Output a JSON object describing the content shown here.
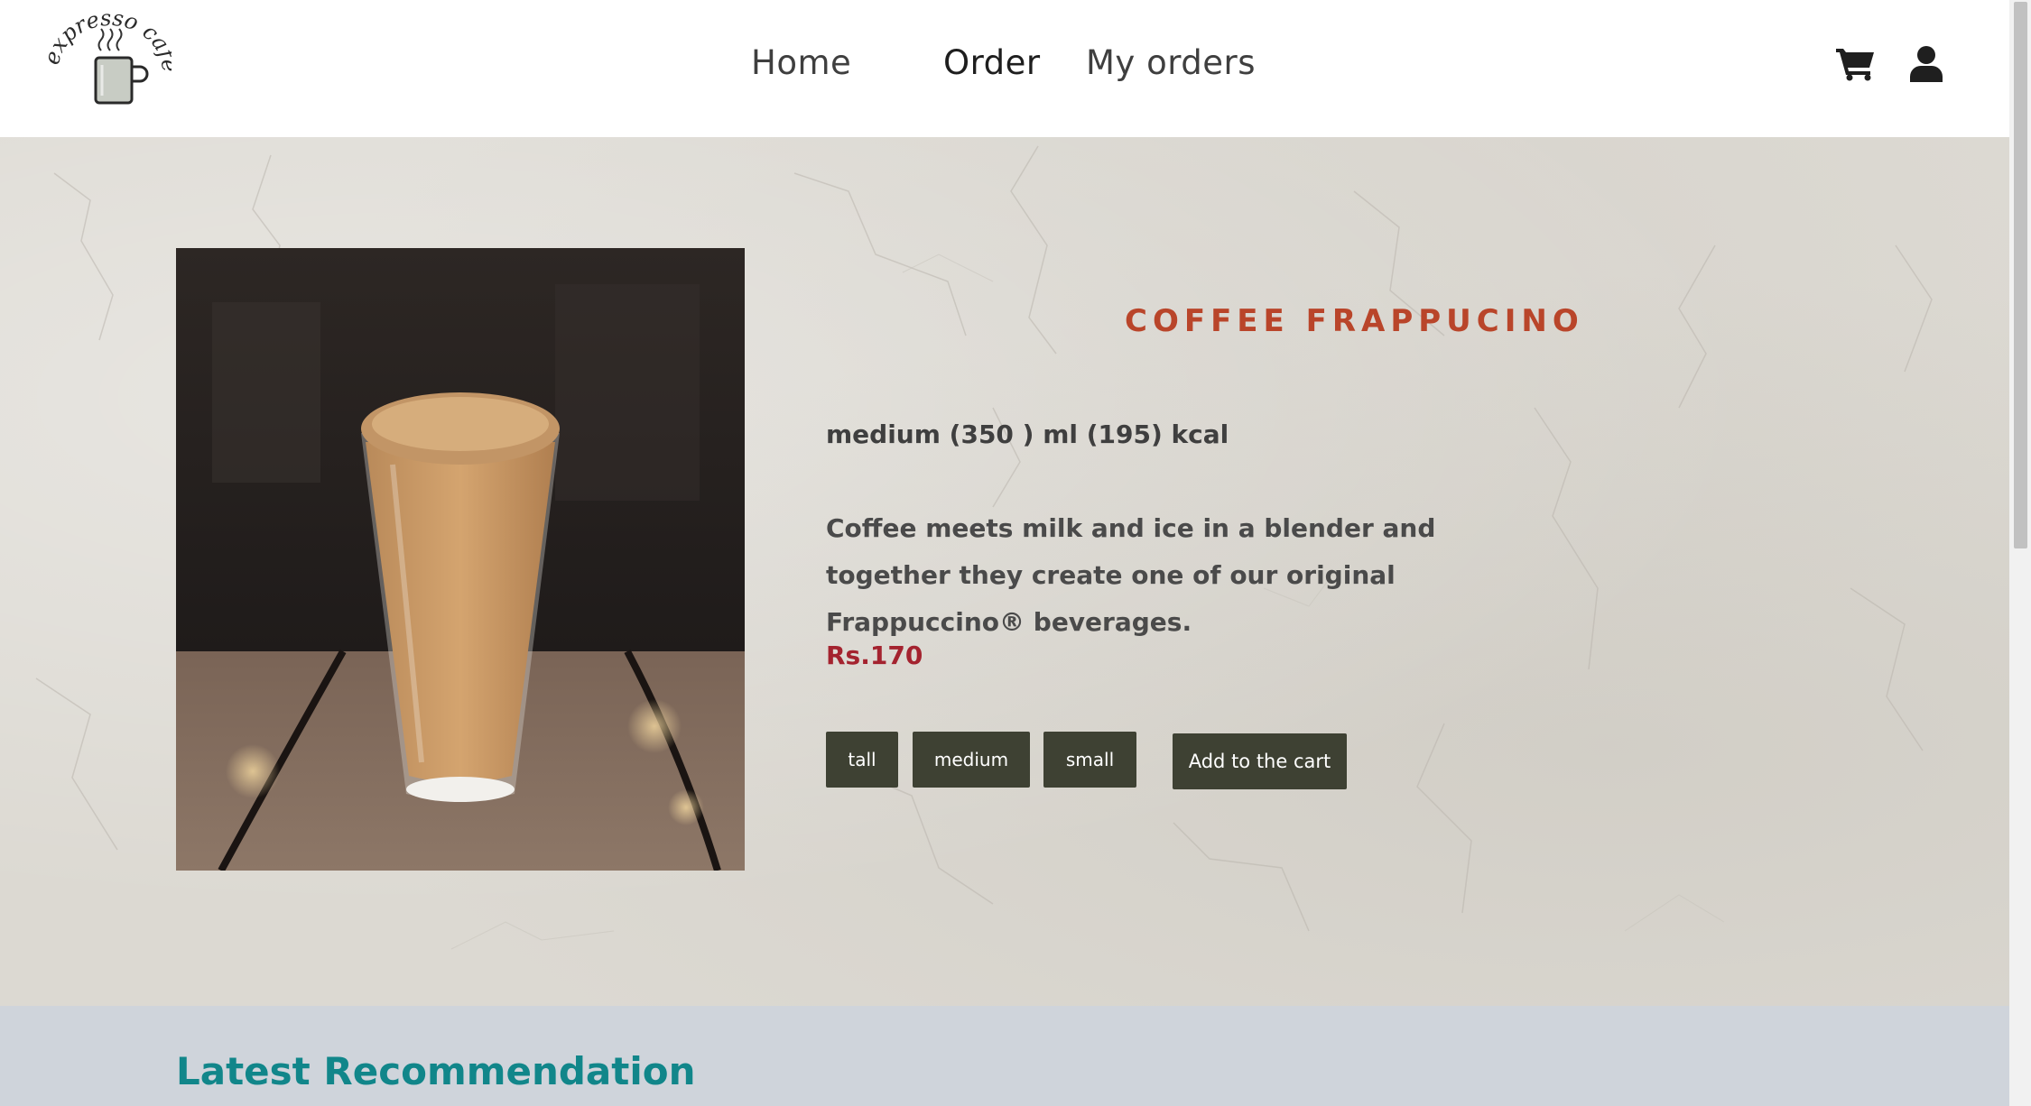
{
  "header": {
    "logo_text": "expresso cafe",
    "nav": [
      {
        "label": "Home"
      },
      {
        "label": "Order"
      },
      {
        "label": "My orders"
      }
    ],
    "icons": [
      "cart-icon",
      "user-icon"
    ]
  },
  "product": {
    "title": "COFFEE FRAPPUCINO",
    "spec": "medium (350 ) ml (195) kcal",
    "description": "Coffee meets milk and ice in a blender and together they create one of our original Frappuccino® beverages.",
    "price": "Rs.170",
    "sizes": [
      {
        "label": "tall"
      },
      {
        "label": "medium"
      },
      {
        "label": "small"
      }
    ],
    "add_to_cart": "Add to the cart"
  },
  "recommendation": {
    "title": "Latest Recommendation"
  },
  "colors": {
    "accent_title": "#b9452a",
    "price": "#a4232f",
    "button_bg": "#3e4133",
    "reco_title": "#11868a",
    "reco_bg": "#cfd4db"
  }
}
